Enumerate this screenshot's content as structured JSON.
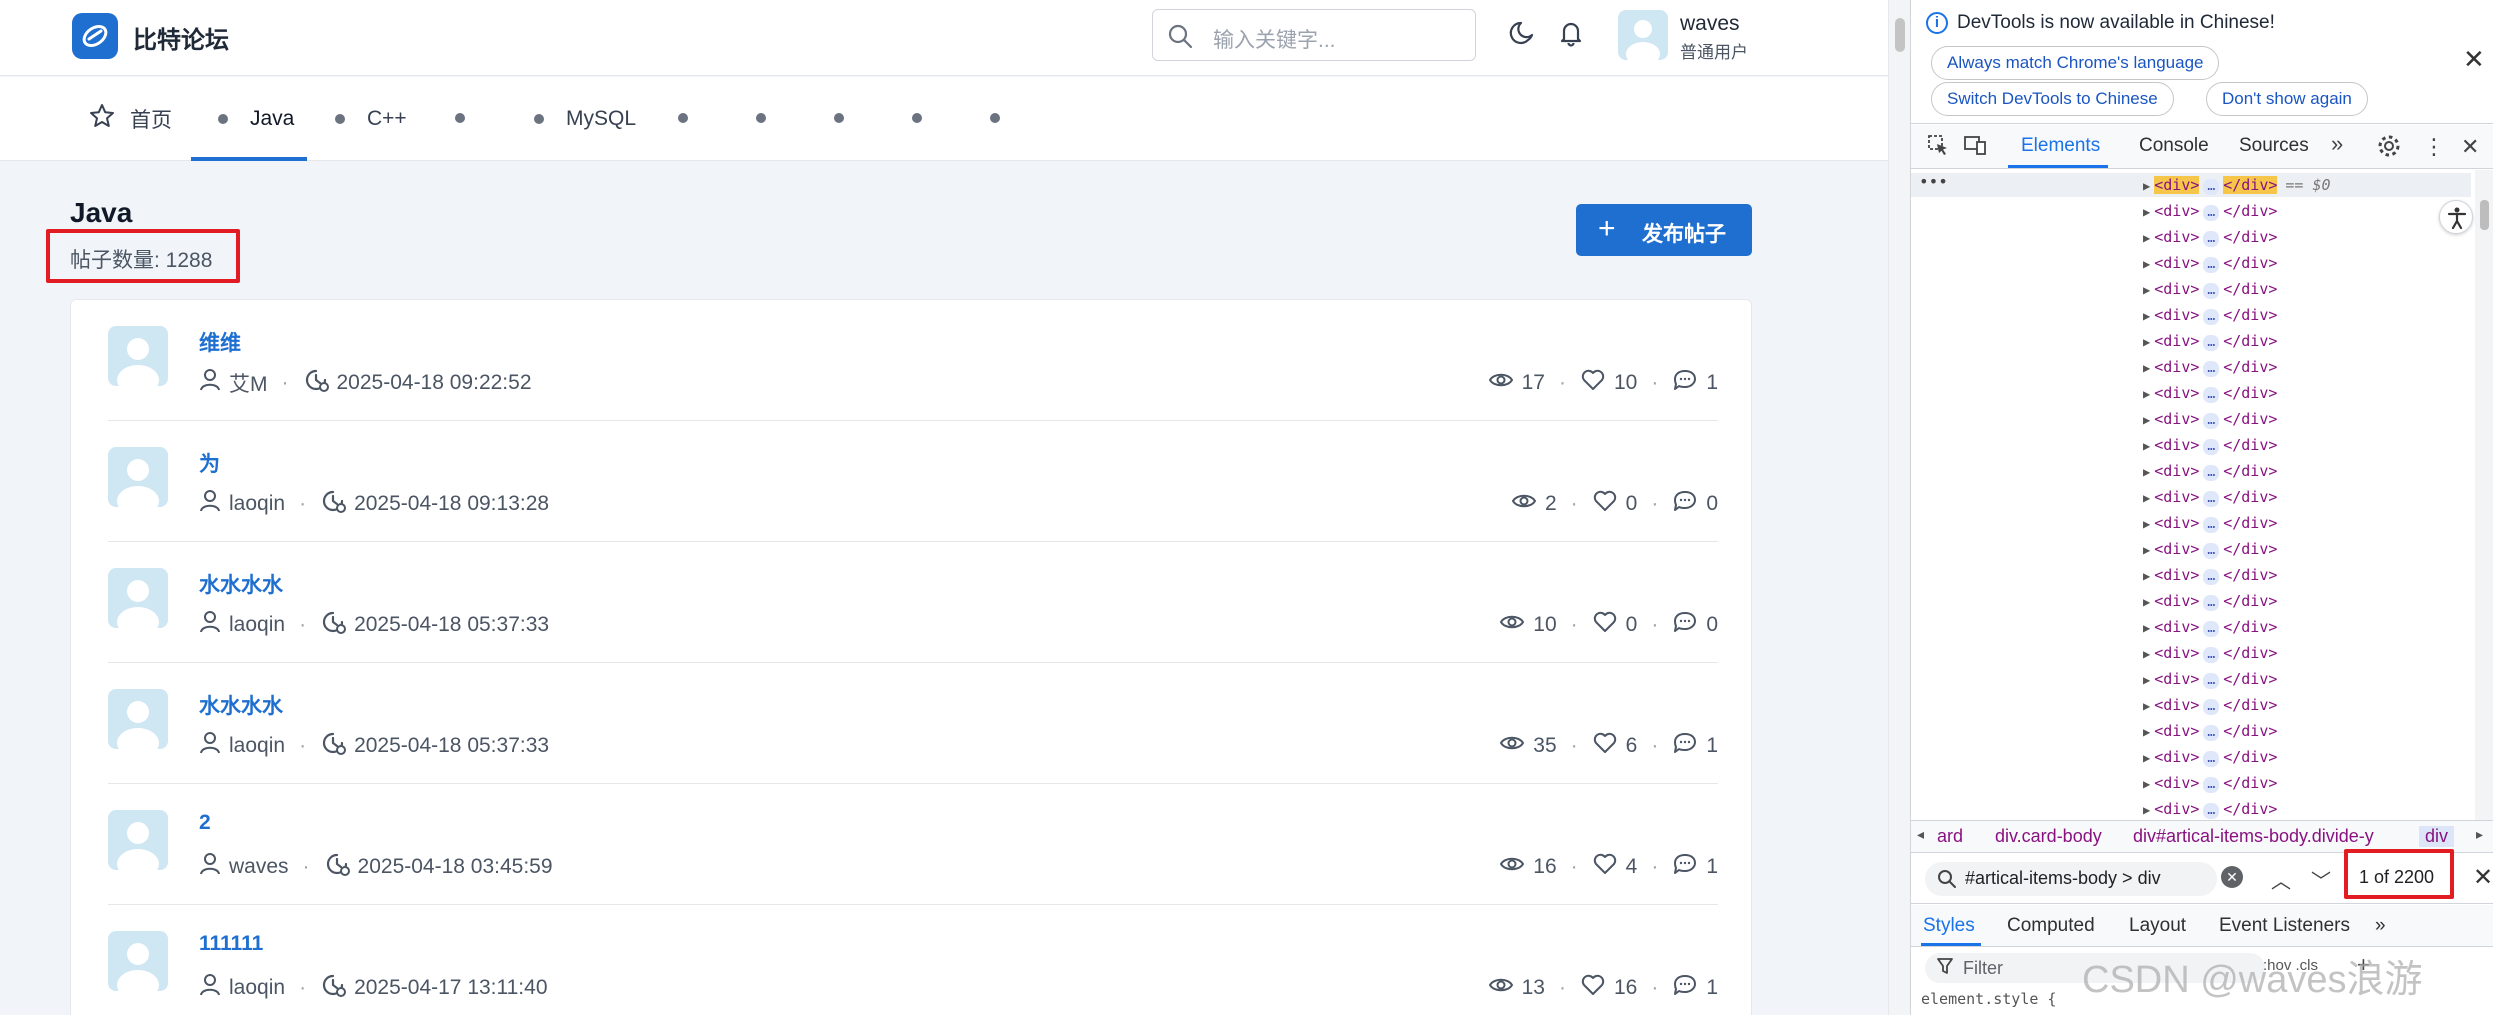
{
  "site": {
    "brand": "比特论坛",
    "search_placeholder": "输入关键字...",
    "user": {
      "name": "waves",
      "role": "普通用户"
    },
    "nav": {
      "home": "首页",
      "items": [
        "Java",
        "C++",
        "MySQL"
      ],
      "active": "Java"
    },
    "board": {
      "title": "Java",
      "post_count": "帖子数量: 1288",
      "publish_label": "发布帖子"
    },
    "posts": [
      {
        "title": "维维",
        "author": "艾M",
        "time": "2025-04-18 09:22:52",
        "views": "17",
        "likes": "10",
        "replies": "1"
      },
      {
        "title": "为",
        "author": "laoqin",
        "time": "2025-04-18 09:13:28",
        "views": "2",
        "likes": "0",
        "replies": "0"
      },
      {
        "title": "水水水水",
        "author": "laoqin",
        "time": "2025-04-18 05:37:33",
        "views": "10",
        "likes": "0",
        "replies": "0"
      },
      {
        "title": "水水水水",
        "author": "laoqin",
        "time": "2025-04-18 05:37:33",
        "views": "35",
        "likes": "6",
        "replies": "1"
      },
      {
        "title": "2",
        "author": "waves",
        "time": "2025-04-18 03:45:59",
        "views": "16",
        "likes": "4",
        "replies": "1"
      },
      {
        "title": "111111",
        "author": "laoqin",
        "time": "2025-04-17 13:11:40",
        "views": "13",
        "likes": "16",
        "replies": "1"
      }
    ]
  },
  "devtools": {
    "info_message": "DevTools is now available in Chinese!",
    "info_buttons": [
      "Always match Chrome's language",
      "Switch DevTools to Chinese",
      "Don't show again"
    ],
    "tabs": [
      "Elements",
      "Console",
      "Sources"
    ],
    "active_tab": "Elements",
    "selected_suffix": "== $0",
    "tree_tag_open": "<div>",
    "tree_tag_close": "</div>",
    "tree_ellipsis": "…",
    "breadcrumbs": [
      "ard",
      "div.card-body",
      "div#artical-items-body.divide-y",
      "div"
    ],
    "find_query": "#artical-items-body > div",
    "find_count": "1 of 2200",
    "style_tabs": [
      "Styles",
      "Computed",
      "Layout",
      "Event Listeners"
    ],
    "filter_placeholder": "Filter",
    "filter_extra": ":hov .cls",
    "element_style": "element.style {"
  },
  "watermark": "CSDN @waves浪游",
  "colors": {
    "primary": "#1f6fd1",
    "highlight_box": "#e11d23",
    "devtools_blue": "#1a73e8"
  }
}
